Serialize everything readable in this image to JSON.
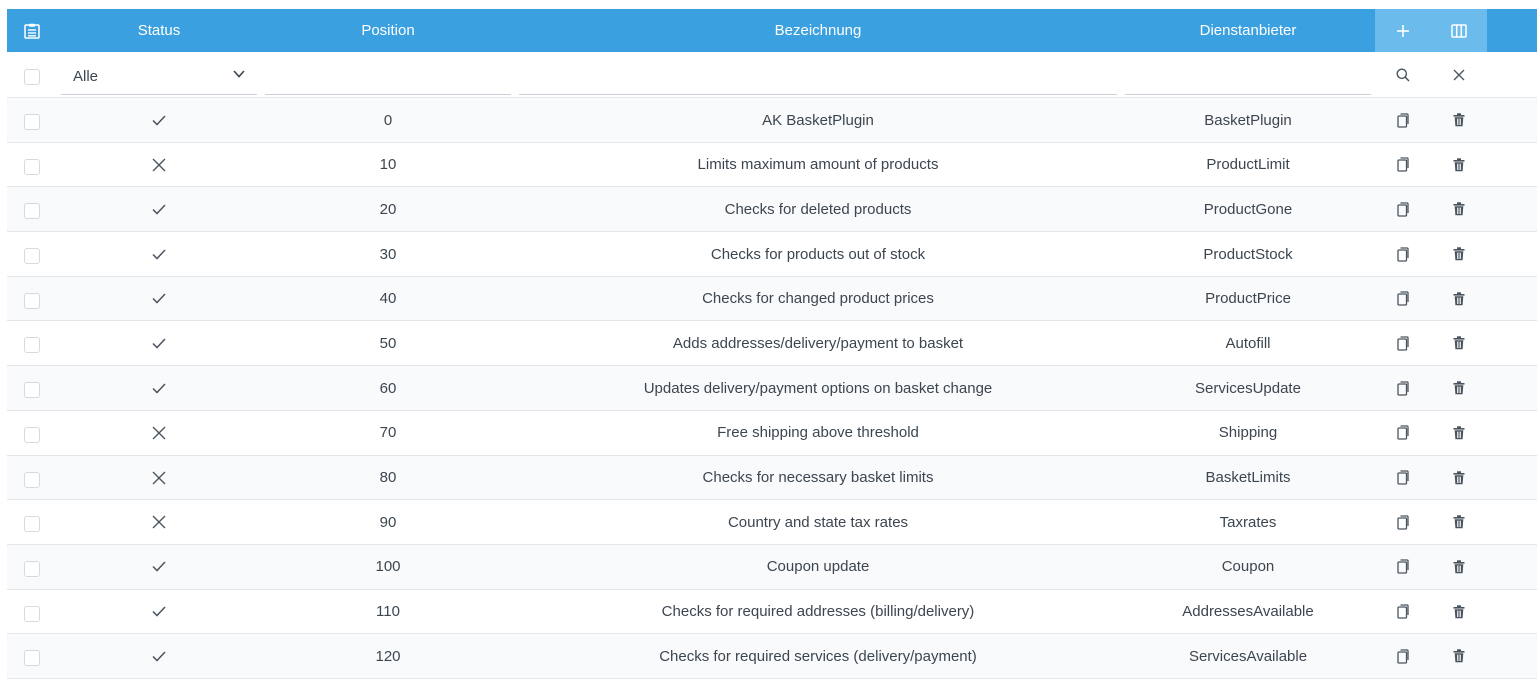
{
  "header": {
    "status": "Status",
    "position": "Position",
    "bezeichnung": "Bezeichnung",
    "dienstanbieter": "Dienstanbieter",
    "icons": {
      "list": "clipboard-list-icon",
      "add": "plus-icon",
      "columns": "columns-icon"
    }
  },
  "filter": {
    "status_value": "Alle",
    "position_value": "",
    "bezeichnung_value": "",
    "dienstanbieter_value": "",
    "icons": {
      "search": "search-icon",
      "clear": "close-icon"
    }
  },
  "colors": {
    "header_bg": "#3aa0e0",
    "header_action_bg": "#6bbbed"
  },
  "rows": [
    {
      "status": "active",
      "position": "0",
      "label": "AK BasketPlugin",
      "provider": "BasketPlugin"
    },
    {
      "status": "inactive",
      "position": "10",
      "label": "Limits maximum amount of products",
      "provider": "ProductLimit"
    },
    {
      "status": "active",
      "position": "20",
      "label": "Checks for deleted products",
      "provider": "ProductGone"
    },
    {
      "status": "active",
      "position": "30",
      "label": "Checks for products out of stock",
      "provider": "ProductStock"
    },
    {
      "status": "active",
      "position": "40",
      "label": "Checks for changed product prices",
      "provider": "ProductPrice"
    },
    {
      "status": "active",
      "position": "50",
      "label": "Adds addresses/delivery/payment to basket",
      "provider": "Autofill"
    },
    {
      "status": "active",
      "position": "60",
      "label": "Updates delivery/payment options on basket change",
      "provider": "ServicesUpdate"
    },
    {
      "status": "inactive",
      "position": "70",
      "label": "Free shipping above threshold",
      "provider": "Shipping"
    },
    {
      "status": "inactive",
      "position": "80",
      "label": "Checks for necessary basket limits",
      "provider": "BasketLimits"
    },
    {
      "status": "inactive",
      "position": "90",
      "label": "Country and state tax rates",
      "provider": "Taxrates"
    },
    {
      "status": "active",
      "position": "100",
      "label": "Coupon update",
      "provider": "Coupon"
    },
    {
      "status": "active",
      "position": "110",
      "label": "Checks for required addresses (billing/delivery)",
      "provider": "AddressesAvailable"
    },
    {
      "status": "active",
      "position": "120",
      "label": "Checks for required services (delivery/payment)",
      "provider": "ServicesAvailable"
    }
  ]
}
